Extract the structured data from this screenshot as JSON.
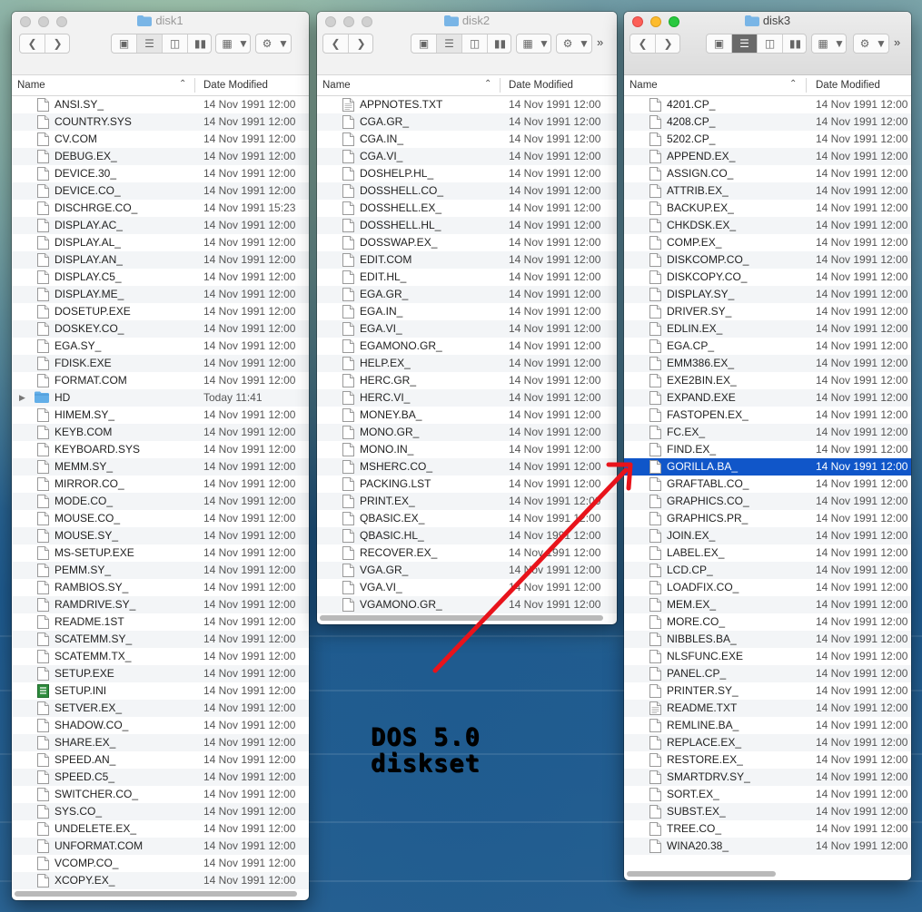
{
  "windows": [
    {
      "id": "disk1",
      "title": "disk1",
      "active": false,
      "columns": {
        "name": "Name",
        "date": "Date Modified"
      },
      "files": [
        {
          "name": "ANSI.SY_",
          "date": "14 Nov 1991 12:00",
          "icon": "doc-icon"
        },
        {
          "name": "COUNTRY.SYS",
          "date": "14 Nov 1991 12:00",
          "icon": "doc-icon"
        },
        {
          "name": "CV.COM",
          "date": "14 Nov 1991 12:00",
          "icon": "doc-icon"
        },
        {
          "name": "DEBUG.EX_",
          "date": "14 Nov 1991 12:00",
          "icon": "doc-icon"
        },
        {
          "name": "DEVICE.30_",
          "date": "14 Nov 1991 12:00",
          "icon": "doc-icon"
        },
        {
          "name": "DEVICE.CO_",
          "date": "14 Nov 1991 12:00",
          "icon": "doc-icon"
        },
        {
          "name": "DISCHRGE.CO_",
          "date": "14 Nov 1991 15:23",
          "icon": "doc-icon"
        },
        {
          "name": "DISPLAY.AC_",
          "date": "14 Nov 1991 12:00",
          "icon": "doc-icon"
        },
        {
          "name": "DISPLAY.AL_",
          "date": "14 Nov 1991 12:00",
          "icon": "doc-icon"
        },
        {
          "name": "DISPLAY.AN_",
          "date": "14 Nov 1991 12:00",
          "icon": "doc-icon"
        },
        {
          "name": "DISPLAY.C5_",
          "date": "14 Nov 1991 12:00",
          "icon": "doc-icon"
        },
        {
          "name": "DISPLAY.ME_",
          "date": "14 Nov 1991 12:00",
          "icon": "doc-icon"
        },
        {
          "name": "DOSETUP.EXE",
          "date": "14 Nov 1991 12:00",
          "icon": "doc-icon"
        },
        {
          "name": "DOSKEY.CO_",
          "date": "14 Nov 1991 12:00",
          "icon": "doc-icon"
        },
        {
          "name": "EGA.SY_",
          "date": "14 Nov 1991 12:00",
          "icon": "doc-icon"
        },
        {
          "name": "FDISK.EXE",
          "date": "14 Nov 1991 12:00",
          "icon": "doc-icon"
        },
        {
          "name": "FORMAT.COM",
          "date": "14 Nov 1991 12:00",
          "icon": "doc-icon"
        },
        {
          "name": "HD",
          "date": "Today 11:41",
          "icon": "folder-icon",
          "folder": true
        },
        {
          "name": "HIMEM.SY_",
          "date": "14 Nov 1991 12:00",
          "icon": "doc-icon"
        },
        {
          "name": "KEYB.COM",
          "date": "14 Nov 1991 12:00",
          "icon": "doc-icon"
        },
        {
          "name": "KEYBOARD.SYS",
          "date": "14 Nov 1991 12:00",
          "icon": "doc-icon"
        },
        {
          "name": "MEMM.SY_",
          "date": "14 Nov 1991 12:00",
          "icon": "doc-icon"
        },
        {
          "name": "MIRROR.CO_",
          "date": "14 Nov 1991 12:00",
          "icon": "doc-icon"
        },
        {
          "name": "MODE.CO_",
          "date": "14 Nov 1991 12:00",
          "icon": "doc-icon"
        },
        {
          "name": "MOUSE.CO_",
          "date": "14 Nov 1991 12:00",
          "icon": "doc-icon"
        },
        {
          "name": "MOUSE.SY_",
          "date": "14 Nov 1991 12:00",
          "icon": "doc-icon"
        },
        {
          "name": "MS-SETUP.EXE",
          "date": "14 Nov 1991 12:00",
          "icon": "doc-icon"
        },
        {
          "name": "PEMM.SY_",
          "date": "14 Nov 1991 12:00",
          "icon": "doc-icon"
        },
        {
          "name": "RAMBIOS.SY_",
          "date": "14 Nov 1991 12:00",
          "icon": "doc-icon"
        },
        {
          "name": "RAMDRIVE.SY_",
          "date": "14 Nov 1991 12:00",
          "icon": "doc-icon"
        },
        {
          "name": "README.1ST",
          "date": "14 Nov 1991 12:00",
          "icon": "doc-icon"
        },
        {
          "name": "SCATEMM.SY_",
          "date": "14 Nov 1991 12:00",
          "icon": "doc-icon"
        },
        {
          "name": "SCATEMM.TX_",
          "date": "14 Nov 1991 12:00",
          "icon": "doc-icon"
        },
        {
          "name": "SETUP.EXE",
          "date": "14 Nov 1991 12:00",
          "icon": "doc-icon"
        },
        {
          "name": "SETUP.INI",
          "date": "14 Nov 1991 12:00",
          "icon": "ini-icon"
        },
        {
          "name": "SETVER.EX_",
          "date": "14 Nov 1991 12:00",
          "icon": "doc-icon"
        },
        {
          "name": "SHADOW.CO_",
          "date": "14 Nov 1991 12:00",
          "icon": "doc-icon"
        },
        {
          "name": "SHARE.EX_",
          "date": "14 Nov 1991 12:00",
          "icon": "doc-icon"
        },
        {
          "name": "SPEED.AN_",
          "date": "14 Nov 1991 12:00",
          "icon": "doc-icon"
        },
        {
          "name": "SPEED.C5_",
          "date": "14 Nov 1991 12:00",
          "icon": "doc-icon"
        },
        {
          "name": "SWITCHER.CO_",
          "date": "14 Nov 1991 12:00",
          "icon": "doc-icon"
        },
        {
          "name": "SYS.CO_",
          "date": "14 Nov 1991 12:00",
          "icon": "doc-icon"
        },
        {
          "name": "UNDELETE.EX_",
          "date": "14 Nov 1991 12:00",
          "icon": "doc-icon"
        },
        {
          "name": "UNFORMAT.COM",
          "date": "14 Nov 1991 12:00",
          "icon": "doc-icon"
        },
        {
          "name": "VCOMP.CO_",
          "date": "14 Nov 1991 12:00",
          "icon": "doc-icon"
        },
        {
          "name": "XCOPY.EX_",
          "date": "14 Nov 1991 12:00",
          "icon": "doc-icon"
        }
      ]
    },
    {
      "id": "disk2",
      "title": "disk2",
      "active": false,
      "columns": {
        "name": "Name",
        "date": "Date Modified"
      },
      "files": [
        {
          "name": "APPNOTES.TXT",
          "date": "14 Nov 1991 12:00",
          "icon": "text-doc-icon"
        },
        {
          "name": "CGA.GR_",
          "date": "14 Nov 1991 12:00",
          "icon": "doc-icon"
        },
        {
          "name": "CGA.IN_",
          "date": "14 Nov 1991 12:00",
          "icon": "doc-icon"
        },
        {
          "name": "CGA.VI_",
          "date": "14 Nov 1991 12:00",
          "icon": "doc-icon"
        },
        {
          "name": "DOSHELP.HL_",
          "date": "14 Nov 1991 12:00",
          "icon": "doc-icon"
        },
        {
          "name": "DOSSHELL.CO_",
          "date": "14 Nov 1991 12:00",
          "icon": "doc-icon"
        },
        {
          "name": "DOSSHELL.EX_",
          "date": "14 Nov 1991 12:00",
          "icon": "doc-icon"
        },
        {
          "name": "DOSSHELL.HL_",
          "date": "14 Nov 1991 12:00",
          "icon": "doc-icon"
        },
        {
          "name": "DOSSWAP.EX_",
          "date": "14 Nov 1991 12:00",
          "icon": "doc-icon"
        },
        {
          "name": "EDIT.COM",
          "date": "14 Nov 1991 12:00",
          "icon": "doc-icon"
        },
        {
          "name": "EDIT.HL_",
          "date": "14 Nov 1991 12:00",
          "icon": "doc-icon"
        },
        {
          "name": "EGA.GR_",
          "date": "14 Nov 1991 12:00",
          "icon": "doc-icon"
        },
        {
          "name": "EGA.IN_",
          "date": "14 Nov 1991 12:00",
          "icon": "doc-icon"
        },
        {
          "name": "EGA.VI_",
          "date": "14 Nov 1991 12:00",
          "icon": "doc-icon"
        },
        {
          "name": "EGAMONO.GR_",
          "date": "14 Nov 1991 12:00",
          "icon": "doc-icon"
        },
        {
          "name": "HELP.EX_",
          "date": "14 Nov 1991 12:00",
          "icon": "doc-icon"
        },
        {
          "name": "HERC.GR_",
          "date": "14 Nov 1991 12:00",
          "icon": "doc-icon"
        },
        {
          "name": "HERC.VI_",
          "date": "14 Nov 1991 12:00",
          "icon": "doc-icon"
        },
        {
          "name": "MONEY.BA_",
          "date": "14 Nov 1991 12:00",
          "icon": "doc-icon"
        },
        {
          "name": "MONO.GR_",
          "date": "14 Nov 1991 12:00",
          "icon": "doc-icon"
        },
        {
          "name": "MONO.IN_",
          "date": "14 Nov 1991 12:00",
          "icon": "doc-icon"
        },
        {
          "name": "MSHERC.CO_",
          "date": "14 Nov 1991 12:00",
          "icon": "doc-icon"
        },
        {
          "name": "PACKING.LST",
          "date": "14 Nov 1991 12:00",
          "icon": "doc-icon"
        },
        {
          "name": "PRINT.EX_",
          "date": "14 Nov 1991 12:00",
          "icon": "doc-icon"
        },
        {
          "name": "QBASIC.EX_",
          "date": "14 Nov 1991 12:00",
          "icon": "doc-icon"
        },
        {
          "name": "QBASIC.HL_",
          "date": "14 Nov 1991 12:00",
          "icon": "doc-icon"
        },
        {
          "name": "RECOVER.EX_",
          "date": "14 Nov 1991 12:00",
          "icon": "doc-icon"
        },
        {
          "name": "VGA.GR_",
          "date": "14 Nov 1991 12:00",
          "icon": "doc-icon"
        },
        {
          "name": "VGA.VI_",
          "date": "14 Nov 1991 12:00",
          "icon": "doc-icon"
        },
        {
          "name": "VGAMONO.GR_",
          "date": "14 Nov 1991 12:00",
          "icon": "doc-icon"
        }
      ]
    },
    {
      "id": "disk3",
      "title": "disk3",
      "active": true,
      "columns": {
        "name": "Name",
        "date": "Date Modified"
      },
      "files": [
        {
          "name": "4201.CP_",
          "date": "14 Nov 1991 12:00",
          "icon": "doc-icon"
        },
        {
          "name": "4208.CP_",
          "date": "14 Nov 1991 12:00",
          "icon": "doc-icon"
        },
        {
          "name": "5202.CP_",
          "date": "14 Nov 1991 12:00",
          "icon": "doc-icon"
        },
        {
          "name": "APPEND.EX_",
          "date": "14 Nov 1991 12:00",
          "icon": "doc-icon"
        },
        {
          "name": "ASSIGN.CO_",
          "date": "14 Nov 1991 12:00",
          "icon": "doc-icon"
        },
        {
          "name": "ATTRIB.EX_",
          "date": "14 Nov 1991 12:00",
          "icon": "doc-icon"
        },
        {
          "name": "BACKUP.EX_",
          "date": "14 Nov 1991 12:00",
          "icon": "doc-icon"
        },
        {
          "name": "CHKDSK.EX_",
          "date": "14 Nov 1991 12:00",
          "icon": "doc-icon"
        },
        {
          "name": "COMP.EX_",
          "date": "14 Nov 1991 12:00",
          "icon": "doc-icon"
        },
        {
          "name": "DISKCOMP.CO_",
          "date": "14 Nov 1991 12:00",
          "icon": "doc-icon"
        },
        {
          "name": "DISKCOPY.CO_",
          "date": "14 Nov 1991 12:00",
          "icon": "doc-icon"
        },
        {
          "name": "DISPLAY.SY_",
          "date": "14 Nov 1991 12:00",
          "icon": "doc-icon"
        },
        {
          "name": "DRIVER.SY_",
          "date": "14 Nov 1991 12:00",
          "icon": "doc-icon"
        },
        {
          "name": "EDLIN.EX_",
          "date": "14 Nov 1991 12:00",
          "icon": "doc-icon"
        },
        {
          "name": "EGA.CP_",
          "date": "14 Nov 1991 12:00",
          "icon": "doc-icon"
        },
        {
          "name": "EMM386.EX_",
          "date": "14 Nov 1991 12:00",
          "icon": "doc-icon"
        },
        {
          "name": "EXE2BIN.EX_",
          "date": "14 Nov 1991 12:00",
          "icon": "doc-icon"
        },
        {
          "name": "EXPAND.EXE",
          "date": "14 Nov 1991 12:00",
          "icon": "doc-icon"
        },
        {
          "name": "FASTOPEN.EX_",
          "date": "14 Nov 1991 12:00",
          "icon": "doc-icon"
        },
        {
          "name": "FC.EX_",
          "date": "14 Nov 1991 12:00",
          "icon": "doc-icon"
        },
        {
          "name": "FIND.EX_",
          "date": "14 Nov 1991 12:00",
          "icon": "doc-icon"
        },
        {
          "name": "GORILLA.BA_",
          "date": "14 Nov 1991 12:00",
          "icon": "doc-icon",
          "selected": true
        },
        {
          "name": "GRAFTABL.CO_",
          "date": "14 Nov 1991 12:00",
          "icon": "doc-icon"
        },
        {
          "name": "GRAPHICS.CO_",
          "date": "14 Nov 1991 12:00",
          "icon": "doc-icon"
        },
        {
          "name": "GRAPHICS.PR_",
          "date": "14 Nov 1991 12:00",
          "icon": "doc-icon"
        },
        {
          "name": "JOIN.EX_",
          "date": "14 Nov 1991 12:00",
          "icon": "doc-icon"
        },
        {
          "name": "LABEL.EX_",
          "date": "14 Nov 1991 12:00",
          "icon": "doc-icon"
        },
        {
          "name": "LCD.CP_",
          "date": "14 Nov 1991 12:00",
          "icon": "doc-icon"
        },
        {
          "name": "LOADFIX.CO_",
          "date": "14 Nov 1991 12:00",
          "icon": "doc-icon"
        },
        {
          "name": "MEM.EX_",
          "date": "14 Nov 1991 12:00",
          "icon": "doc-icon"
        },
        {
          "name": "MORE.CO_",
          "date": "14 Nov 1991 12:00",
          "icon": "doc-icon"
        },
        {
          "name": "NIBBLES.BA_",
          "date": "14 Nov 1991 12:00",
          "icon": "doc-icon"
        },
        {
          "name": "NLSFUNC.EXE",
          "date": "14 Nov 1991 12:00",
          "icon": "doc-icon"
        },
        {
          "name": "PANEL.CP_",
          "date": "14 Nov 1991 12:00",
          "icon": "doc-icon"
        },
        {
          "name": "PRINTER.SY_",
          "date": "14 Nov 1991 12:00",
          "icon": "doc-icon"
        },
        {
          "name": "README.TXT",
          "date": "14 Nov 1991 12:00",
          "icon": "text-doc-icon"
        },
        {
          "name": "REMLINE.BA_",
          "date": "14 Nov 1991 12:00",
          "icon": "doc-icon"
        },
        {
          "name": "REPLACE.EX_",
          "date": "14 Nov 1991 12:00",
          "icon": "doc-icon"
        },
        {
          "name": "RESTORE.EX_",
          "date": "14 Nov 1991 12:00",
          "icon": "doc-icon"
        },
        {
          "name": "SMARTDRV.SY_",
          "date": "14 Nov 1991 12:00",
          "icon": "doc-icon"
        },
        {
          "name": "SORT.EX_",
          "date": "14 Nov 1991 12:00",
          "icon": "doc-icon"
        },
        {
          "name": "SUBST.EX_",
          "date": "14 Nov 1991 12:00",
          "icon": "doc-icon"
        },
        {
          "name": "TREE.CO_",
          "date": "14 Nov 1991 12:00",
          "icon": "doc-icon"
        },
        {
          "name": "WINA20.38_",
          "date": "14 Nov 1991 12:00",
          "icon": "doc-icon"
        }
      ]
    }
  ],
  "toolbar": {
    "back_icon": "chevron-left-icon",
    "forward_icon": "chevron-right-icon",
    "views": [
      "icon-view-icon",
      "list-view-icon",
      "column-view-icon",
      "cover-flow-icon"
    ],
    "selected_view": "list",
    "arrange_icon": "arrange-icon",
    "action_icon": "gear-icon",
    "overflow_label": "»"
  },
  "overlay": {
    "caption_line1": "DOS 5.0",
    "caption_line2": "diskset",
    "arrow_color": "#e8131b",
    "selection_color": "#1056c9"
  }
}
